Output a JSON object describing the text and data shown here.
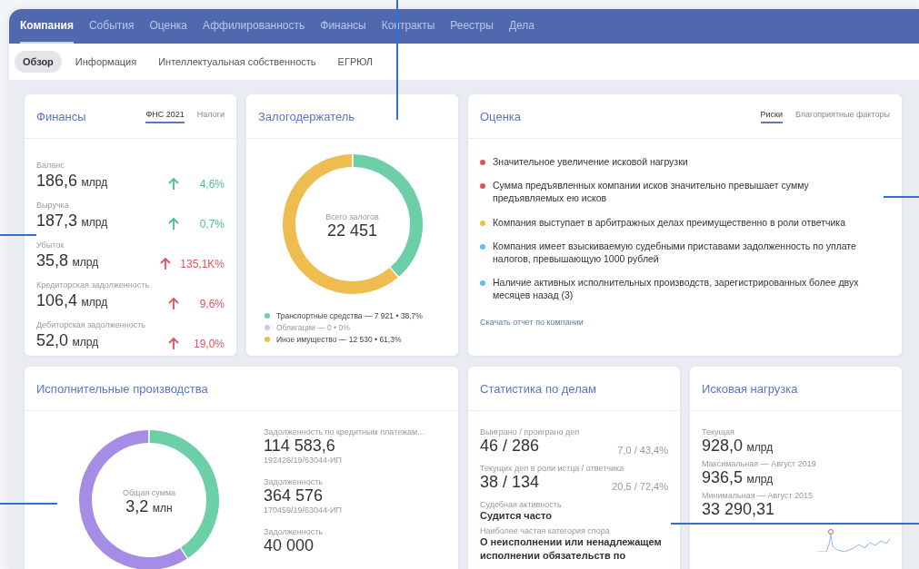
{
  "nav": {
    "tabs": [
      {
        "label": "Компания",
        "selected": true
      },
      {
        "label": "События",
        "selected": false
      },
      {
        "label": "Оценка",
        "selected": false
      },
      {
        "label": "Аффилированность",
        "selected": false
      },
      {
        "label": "Финансы",
        "selected": false
      },
      {
        "label": "Контракты",
        "selected": false
      },
      {
        "label": "Реестры",
        "selected": false
      },
      {
        "label": "Дела",
        "selected": false
      }
    ]
  },
  "subnav": {
    "tabs": [
      {
        "label": "Обзор",
        "selected": true
      },
      {
        "label": "Информация",
        "selected": false
      },
      {
        "label": "Интеллектуальная собственность",
        "selected": false
      },
      {
        "label": "ЕГРЮЛ",
        "selected": false
      }
    ]
  },
  "finances": {
    "title": "Финансы",
    "tabs": [
      {
        "label": "ФНС 2021",
        "selected": true
      },
      {
        "label": "Налоги",
        "selected": false
      }
    ],
    "rows": [
      {
        "label": "Баланс",
        "value": "186,6",
        "unit": "млрд",
        "change": "4,6%",
        "color": "#4cbf8f"
      },
      {
        "label": "Выручка",
        "value": "187,3",
        "unit": "млрд",
        "change": "0,7%",
        "color": "#4cbf8f"
      },
      {
        "label": "Убыток",
        "value": "35,8",
        "unit": "млрд",
        "change": "135,1K%",
        "color": "#e0525e"
      },
      {
        "label": "Кредиторская задолженность",
        "value": "106,4",
        "unit": "млрд",
        "change": "9,6%",
        "color": "#e0525e"
      },
      {
        "label": "Дебиторская задолженность",
        "value": "52,0",
        "unit": "млрд",
        "change": "19,0%",
        "color": "#e0525e"
      }
    ]
  },
  "pledge": {
    "title": "Залогодержатель",
    "center_label": "Всего залогов",
    "center_value": "22 451",
    "legend": [
      {
        "text": "Транспортные средства — 7 921 • 38,7%",
        "color": "#6dcfa6",
        "muted": false
      },
      {
        "text": "Облигации — 0 • 0%",
        "color": "#cfc8ee",
        "muted": true
      },
      {
        "text": "Иное имущество — 12 530 • 61,3%",
        "color": "#eebc4f",
        "muted": false
      }
    ]
  },
  "assessment": {
    "title": "Оценка",
    "tabs": [
      {
        "label": "Риски",
        "selected": true
      },
      {
        "label": "Благоприятные факторы",
        "selected": false
      }
    ],
    "items": [
      {
        "text": "Значительное увеличение исковой нагрузки",
        "color": "#e0525e"
      },
      {
        "text": "Сумма предъявленных компании исков значительно превышает сумму предъявляемых ею исков",
        "color": "#e0525e"
      },
      {
        "text": "Компания выступает в арбитражных делах преимущественно в роли ответчика",
        "color": "#eebc4f"
      },
      {
        "text": "Компания имеет взыскиваемую судебными приставами задолженность по уплате налогов, превышающую 1000 рублей",
        "color": "#5bbde8"
      },
      {
        "text": "Наличие активных исполнительных производств, зарегистрированных более двух месяцев назад (3)",
        "color": "#5bbde8"
      }
    ],
    "link": "Скачать отчет по компании"
  },
  "enforcement": {
    "title": "Исполнительные производства",
    "center_label": "Общая сумма",
    "center_value": "3,2",
    "center_unit": "млн",
    "items": [
      {
        "label": "Задолженность по кредитным платежам...",
        "value": "114 583,6",
        "number": "192426/19/63044-ИП"
      },
      {
        "label": "Задолженность",
        "value": "364 576",
        "number": "170459/19/63044-ИП"
      },
      {
        "label": "Задолженность",
        "value": "40 000"
      }
    ]
  },
  "cases": {
    "title": "Статистика по делам",
    "stats": [
      {
        "kind": "ratio",
        "label": "Выиграно / проиграно дел",
        "value": "46 / 286",
        "share": "7,0 / 43,4%"
      },
      {
        "kind": "ratio",
        "label": "Текущих дел в роли истца / ответчика",
        "value": "38 / 134",
        "share": "20,5 / 72,4%"
      },
      {
        "kind": "text",
        "label": "Судебная активность",
        "value": "Судится часто"
      },
      {
        "kind": "text",
        "label": "Наиболее частая категория спора",
        "value": "О неисполнении или ненадлежащем исполнении обязательств по"
      }
    ]
  },
  "claims": {
    "title": "Исковая нагрузка",
    "stats": [
      {
        "label": "Текущая",
        "value": "928,0",
        "unit": "млрд"
      },
      {
        "label": "Максимальная — Август 2019",
        "value": "936,5",
        "unit": "млрд"
      },
      {
        "label": "Минимальная — Август 2015",
        "value": "33 290,31"
      }
    ]
  }
}
